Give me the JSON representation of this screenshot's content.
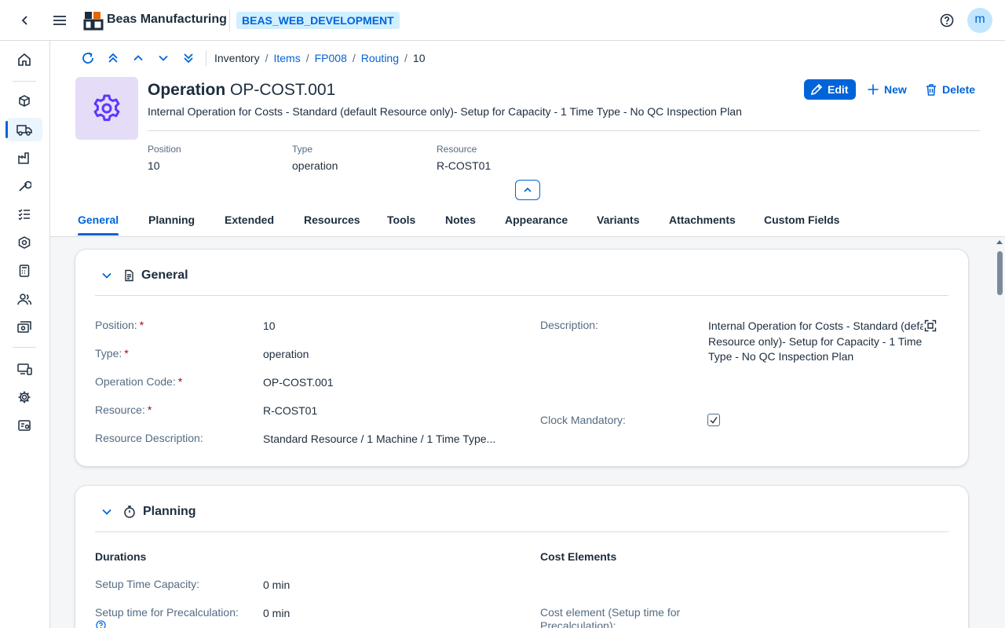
{
  "shell": {
    "brand": "Beas Manufacturing",
    "system": "BEAS_WEB_DEVELOPMENT",
    "avatar_initial": "m"
  },
  "breadcrumb": [
    {
      "label": "Inventory",
      "link": false
    },
    {
      "label": "Items",
      "link": true
    },
    {
      "label": "FP008",
      "link": true
    },
    {
      "label": "Routing",
      "link": true
    },
    {
      "label": "10",
      "link": false
    }
  ],
  "header": {
    "label": "Operation",
    "code": "OP-COST.001",
    "subtitle": "Internal Operation for Costs - Standard (default Resource only)- Setup for Capacity - 1 Time Type - No QC Inspection Plan",
    "actions": {
      "edit": "Edit",
      "new": "New",
      "delete": "Delete"
    },
    "attributes": [
      {
        "key": "Position",
        "value": "10"
      },
      {
        "key": "Type",
        "value": "operation"
      },
      {
        "key": "Resource",
        "value": "R-COST01"
      }
    ]
  },
  "tabs": [
    "General",
    "Planning",
    "Extended",
    "Resources",
    "Tools",
    "Notes",
    "Appearance",
    "Variants",
    "Attachments",
    "Custom Fields"
  ],
  "general": {
    "title": "General",
    "fields": {
      "position": {
        "label": "Position:",
        "value": "10"
      },
      "type": {
        "label": "Type:",
        "value": "operation"
      },
      "operation_code": {
        "label": "Operation Code:",
        "value": "OP-COST.001"
      },
      "resource": {
        "label": "Resource:",
        "value": "R-COST01"
      },
      "resource_description": {
        "label": "Resource Description:",
        "value": "Standard Resource / 1 Machine / 1 Time Type..."
      },
      "description": {
        "label": "Description:",
        "line1": "Internal Operation for Costs - Standard (default",
        "line2": "Resource only)- Setup for Capacity - 1 Time",
        "line3": "Type - No QC Inspection Plan"
      },
      "clock_mandatory": {
        "label": "Clock Mandatory:",
        "checked": true
      }
    }
  },
  "planning": {
    "title": "Planning",
    "durations_heading": "Durations",
    "cost_heading": "Cost Elements",
    "setup_capacity": {
      "label": "Setup Time Capacity:",
      "value": "0 min"
    },
    "setup_precalc": {
      "label": "Setup time for Precalculation:",
      "value": "0 min"
    },
    "cost_setup": {
      "label_line1": "Cost element (Setup time for",
      "label_line2": "Precalculation):"
    }
  }
}
